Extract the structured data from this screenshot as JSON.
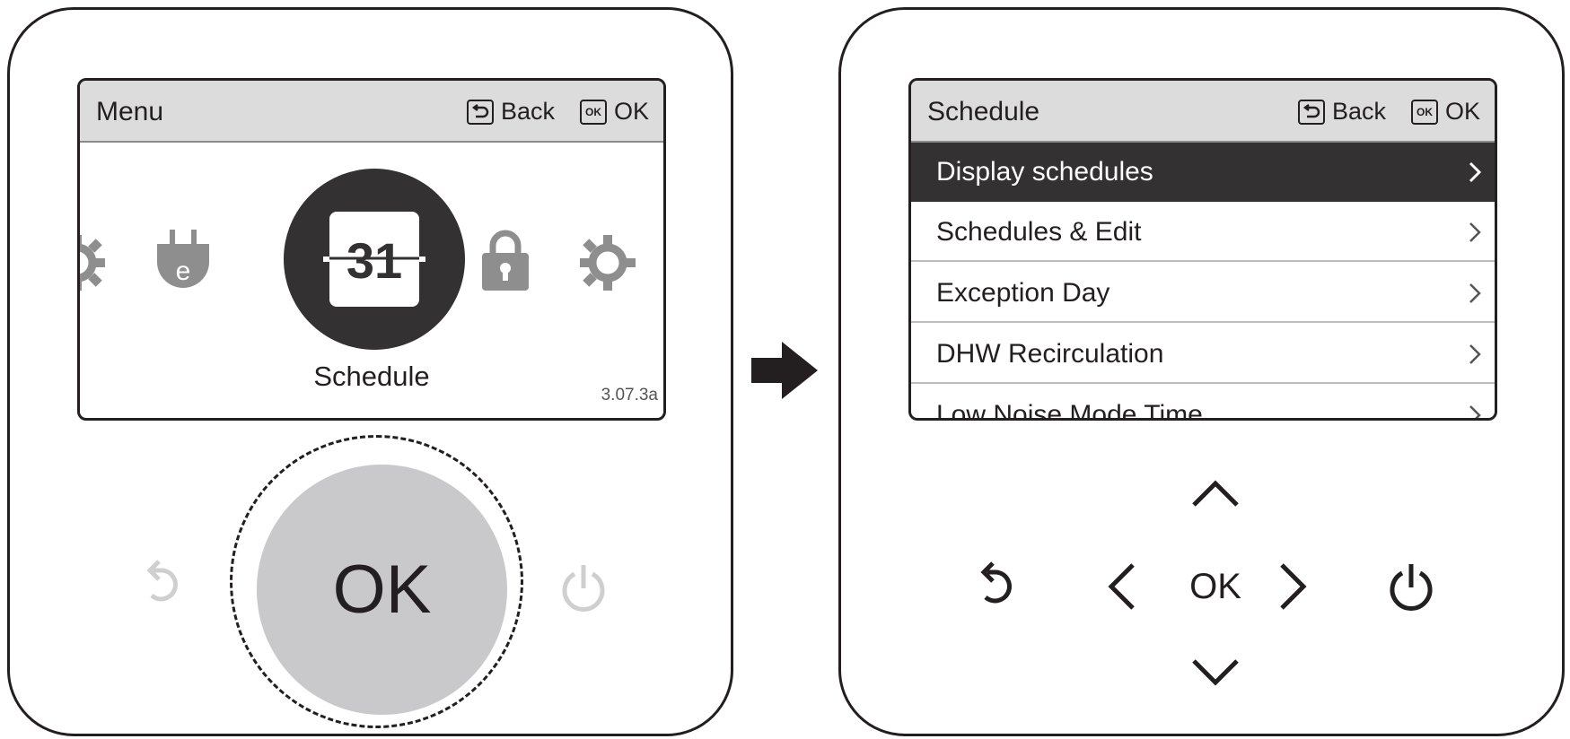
{
  "left": {
    "header": {
      "title": "Menu",
      "back_label": "Back",
      "ok_label": "OK",
      "ok_box": "OK"
    },
    "carousel": {
      "items": [
        "gear-icon",
        "energy-plug-icon",
        "calendar-icon",
        "lock-icon",
        "gear-icon"
      ],
      "selected_icon_text": "31",
      "selected_label": "Schedule"
    },
    "version": "3.07.3a",
    "controls": {
      "ok_label": "OK",
      "back_icon": "back-arrow-icon",
      "power_icon": "power-icon"
    }
  },
  "transition_icon": "right-arrow-icon",
  "right": {
    "header": {
      "title": "Schedule",
      "back_label": "Back",
      "ok_label": "OK",
      "ok_box": "OK"
    },
    "menu": {
      "items": [
        {
          "label": "Display schedules",
          "selected": true
        },
        {
          "label": "Schedules & Edit",
          "selected": false
        },
        {
          "label": "Exception Day",
          "selected": false
        },
        {
          "label": "DHW Recirculation",
          "selected": false
        },
        {
          "label": "Low Noise Mode Time",
          "selected": false
        }
      ]
    },
    "controls": {
      "ok_label": "OK",
      "icons": [
        "up-icon",
        "down-icon",
        "left-icon",
        "right-icon",
        "back-arrow-icon",
        "power-icon"
      ]
    }
  },
  "colors": {
    "dark": "#333132",
    "outline": "#231f20",
    "header_bg": "#dcdcdc",
    "ok_button_bg": "#c9c9cb",
    "disabled_icon": "#cfcfcf"
  }
}
